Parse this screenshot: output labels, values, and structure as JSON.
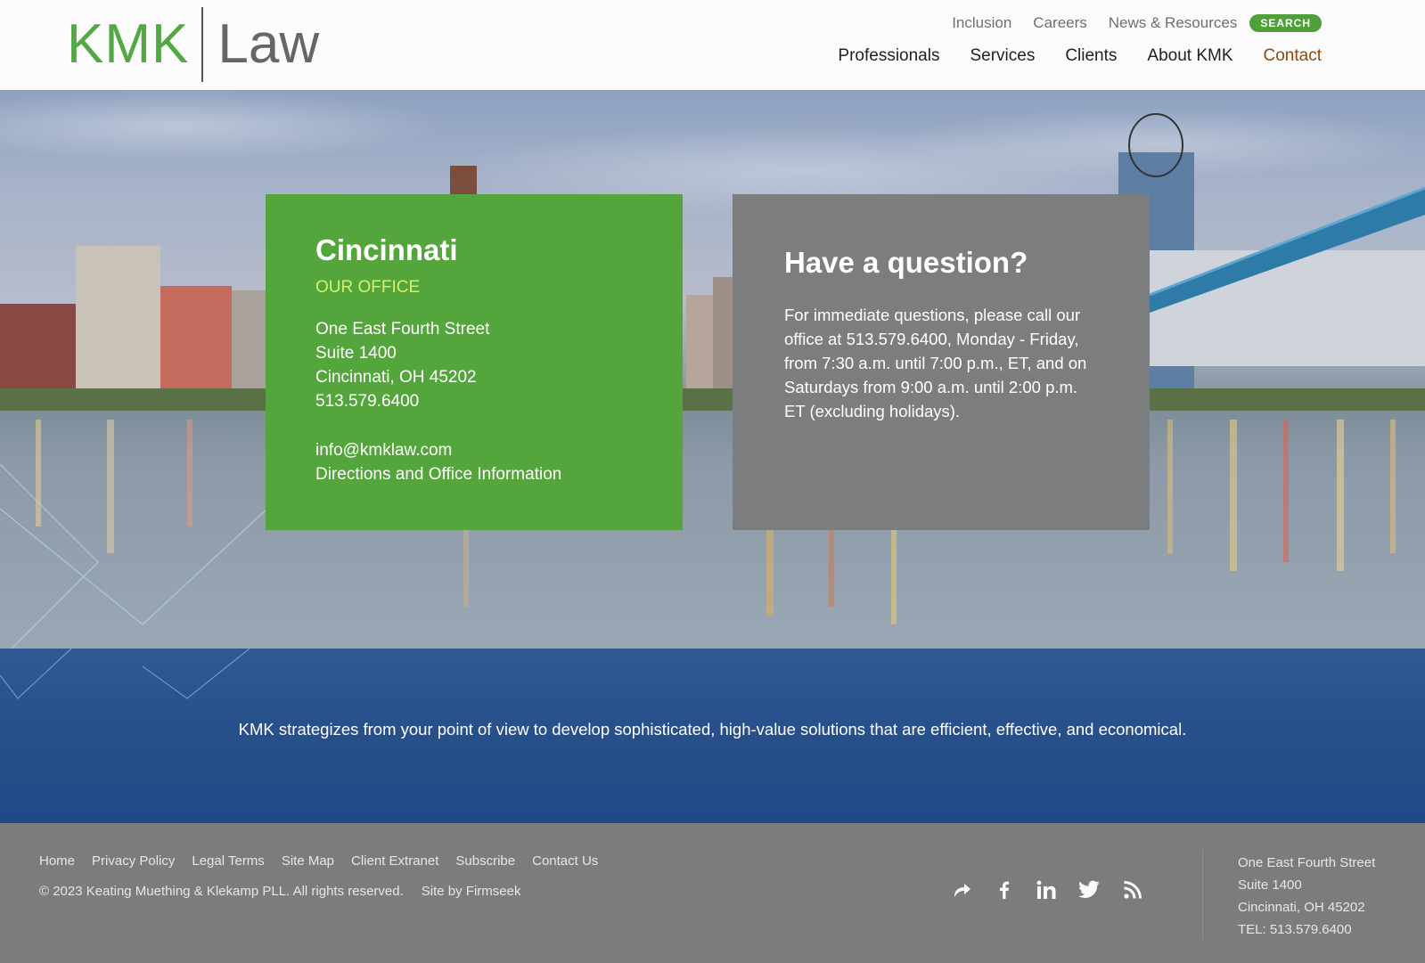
{
  "header": {
    "logo": {
      "left": "KMK",
      "right": "Law"
    },
    "utility_nav": [
      "Inclusion",
      "Careers",
      "News & Resources"
    ],
    "search_label": "SEARCH",
    "main_nav": [
      "Professionals",
      "Services",
      "Clients",
      "About KMK",
      "Contact"
    ],
    "active_nav": "Contact"
  },
  "office": {
    "city": "Cincinnati",
    "label": "OUR OFFICE",
    "address_lines": [
      "One East Fourth Street",
      "Suite 1400",
      "Cincinnati, OH 45202",
      "513.579.6400"
    ],
    "email": "info@kmklaw.com",
    "directions_link": "Directions and Office Information"
  },
  "question": {
    "title": "Have a question?",
    "body": "For immediate questions, please call our office at 513.579.6400, Monday - Friday, from 7:30 a.m. until 7:00 p.m., ET, and on Saturdays from 9:00 a.m. until 2:00 p.m. ET (excluding holidays)."
  },
  "tagline": "KMK strategizes from your point of view to develop sophisticated, high-value solutions that are efficient, effective, and economical.",
  "footer": {
    "links": [
      "Home",
      "Privacy Policy",
      "Legal Terms",
      "Site Map",
      "Client Extranet",
      "Subscribe",
      "Contact Us"
    ],
    "copyright": "© 2023 Keating Muething & Klekamp PLL. All rights reserved.",
    "site_by": "Site by Firmseek",
    "social_icons": [
      "share-icon",
      "facebook-icon",
      "linkedin-icon",
      "twitter-icon",
      "rss-icon"
    ],
    "address_lines": [
      "One East Fourth Street",
      "Suite 1400",
      "Cincinnati, OH 45202",
      "TEL: 513.579.6400"
    ]
  },
  "colors": {
    "brand_green": "#54a844",
    "office_card": "#53a53c",
    "question_card": "#7c7d7f",
    "band_blue": "#28508a",
    "footer_gray": "#7b7c7e",
    "active_nav": "#8a4a12",
    "office_label": "#d8ef6a"
  }
}
